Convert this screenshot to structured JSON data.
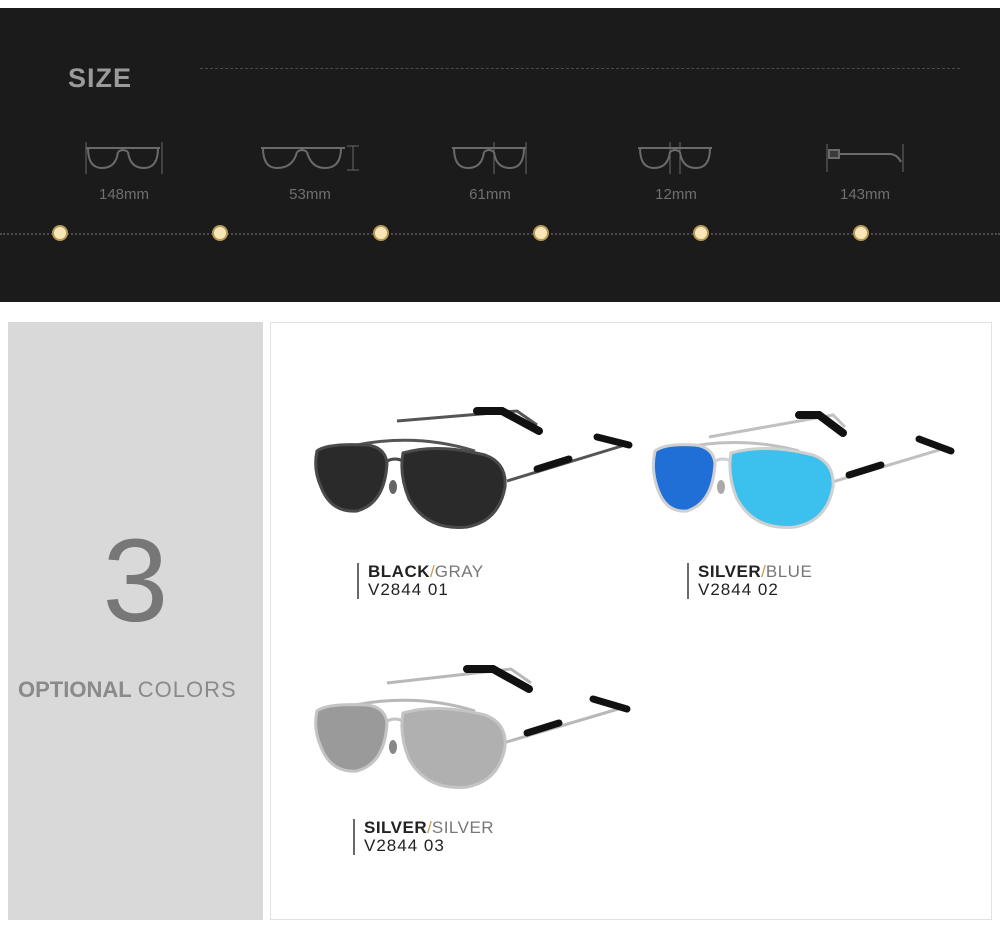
{
  "size_section": {
    "title": "SIZE",
    "dimensions": [
      {
        "value": "148mm",
        "icon": "frame-width-icon"
      },
      {
        "value": "53mm",
        "icon": "lens-height-icon"
      },
      {
        "value": "61mm",
        "icon": "lens-width-icon"
      },
      {
        "value": "12mm",
        "icon": "bridge-width-icon"
      },
      {
        "value": "143mm",
        "icon": "temple-length-icon"
      }
    ],
    "accent_color": "#b79a52"
  },
  "colors_section": {
    "count": "3",
    "label_bold": "OPTIONAL",
    "label_light": "COLORS"
  },
  "products": [
    {
      "frame": "BLACK",
      "lens": "GRAY",
      "code": "V2844  01",
      "lens_color": "#2a2a2a",
      "frame_color": "#4a4a4a"
    },
    {
      "frame": "SILVER",
      "lens": "BLUE",
      "code": "V2844  02",
      "lens_color": "#2aa7e6",
      "frame_color": "#c8c8c8"
    },
    {
      "frame": "SILVER",
      "lens": "SILVER",
      "code": "V2844  03",
      "lens_color": "#9a9a9a",
      "frame_color": "#c8c8c8"
    }
  ],
  "separator": "/"
}
